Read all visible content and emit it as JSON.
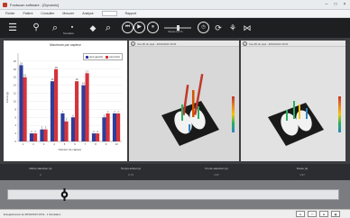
{
  "window": {
    "title": "Footscan software - [Dynamic]",
    "min_glyph": "–",
    "max_glyph": "□",
    "close_glyph": "×"
  },
  "menu": {
    "items": [
      "Fichier",
      "Patient",
      "Consulter",
      "Mesurer",
      "Analyse",
      "",
      "Rapport"
    ],
    "active_index": 5
  },
  "toolbar": {
    "speed_label": "Vitesse 100 %",
    "analysis_label": "Simulation"
  },
  "chart": {
    "title": "Maximum par capteur",
    "legend": {
      "left": "pied gauche",
      "right": "pied droit"
    },
    "colors": {
      "left": "#2e3d9a",
      "right": "#d6323a"
    }
  },
  "chart_data": {
    "type": "bar",
    "title": "Maximum par capteur",
    "xlabel": "Numéro de capteur",
    "ylabel": "Force (g)",
    "ylim": [
      0,
      22
    ],
    "yticks": [
      0,
      2,
      4,
      6,
      8,
      10,
      12,
      14,
      16,
      18,
      20
    ],
    "categories": [
      "1",
      "2",
      "3",
      "4",
      "5",
      "6",
      "7",
      "8",
      "9",
      "10"
    ],
    "series": [
      {
        "name": "pied gauche",
        "values": [
          19,
          2,
          3,
          15,
          7,
          6,
          14,
          2,
          6,
          7
        ]
      },
      {
        "name": "pied droit",
        "values": [
          16,
          2,
          3,
          18,
          5,
          15,
          17,
          2,
          7,
          7
        ]
      }
    ]
  },
  "views": [
    {
      "title": "Vue 3D du pied - 28/10/2013 16:51"
    },
    {
      "title": "Vue 3D du pied - 28/10/2013 16:51"
    }
  ],
  "stats": [
    {
      "label": "Début sélection (s)",
      "value": "0"
    },
    {
      "label": "Temps actuel (s)",
      "value": "0,79"
    },
    {
      "label": "Fin de sélection (s)",
      "value": "4,97"
    },
    {
      "label": "Durée (s)",
      "value": "4,97"
    }
  ],
  "status": {
    "text": "Enregistrement du 28/10/2013 16:51 - 1 Simulation"
  }
}
